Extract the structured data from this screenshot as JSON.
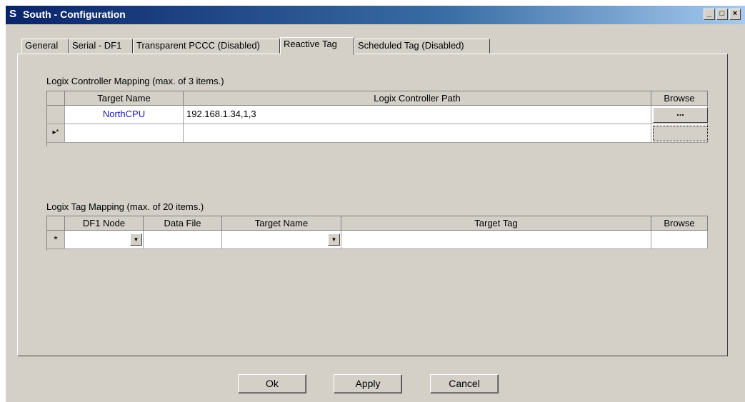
{
  "window": {
    "title": "South - Configuration",
    "app_icon": "S",
    "minimize_label": "_",
    "maximize_label": "□",
    "close_label": "×"
  },
  "tabs": [
    {
      "label": "General",
      "active": false
    },
    {
      "label": "Serial - DF1",
      "active": false
    },
    {
      "label": "Transparent PCCC (Disabled)",
      "active": false
    },
    {
      "label": "Reactive Tag",
      "active": true
    },
    {
      "label": "Scheduled Tag (Disabled)",
      "active": false
    }
  ],
  "controller_mapping": {
    "label": "Logix Controller Mapping (max. of 3 items.)",
    "columns": [
      "Target Name",
      "Logix Controller Path",
      "Browse"
    ],
    "rows": [
      {
        "target_name": "NorthCPU",
        "path": "192.168.1.34,1,3",
        "browse": "..."
      }
    ],
    "new_row_marker": "▸*"
  },
  "tag_mapping": {
    "label": "Logix Tag Mapping (max. of 20 items.)",
    "columns": [
      "DF1 Node",
      "Data File",
      "Target Name",
      "Target Tag",
      "Browse"
    ],
    "new_row_marker": "*"
  },
  "buttons": {
    "ok": "Ok",
    "apply": "Apply",
    "cancel": "Cancel"
  },
  "colors": {
    "title_bar": "#0a246a",
    "dialog_face": "#d4d0c8",
    "link_text": "#1a1aa6"
  }
}
